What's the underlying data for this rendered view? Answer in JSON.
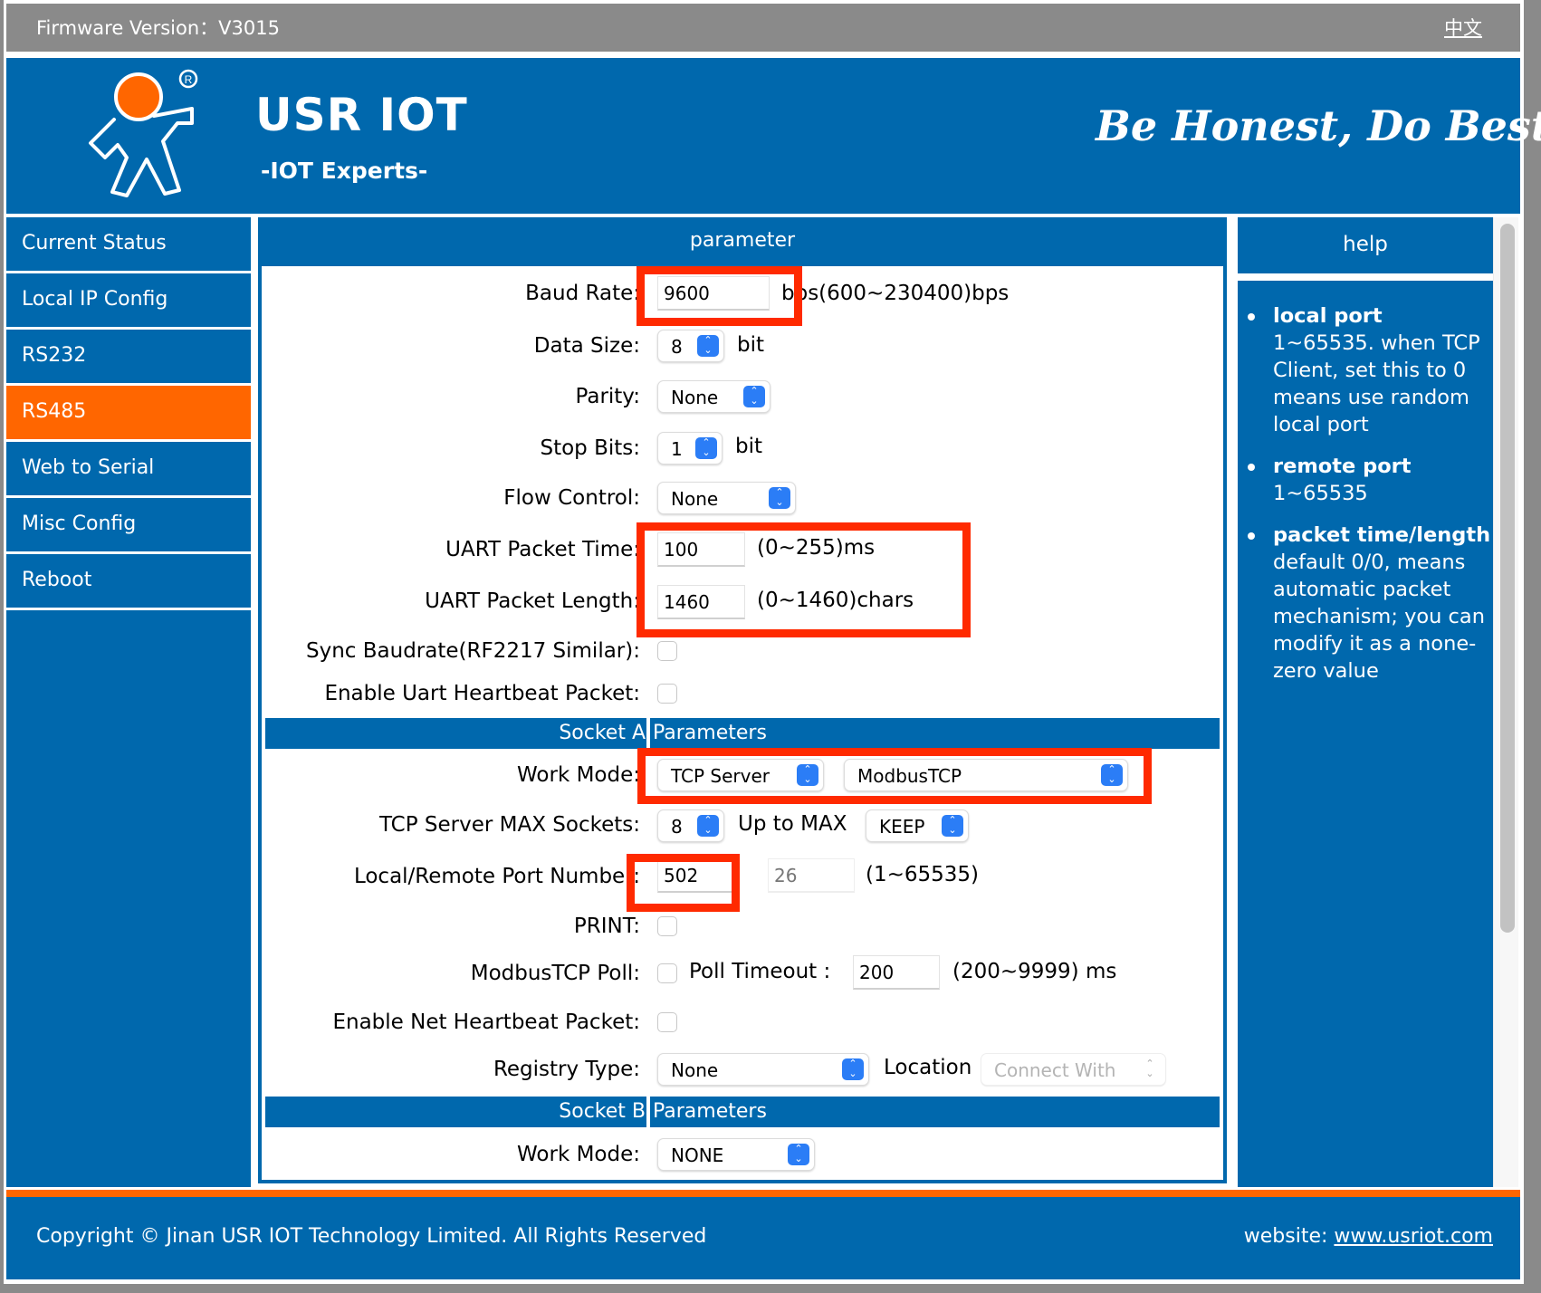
{
  "topbar": {
    "firmware_label": "Firmware Version：V3015",
    "language_link": "中文"
  },
  "header": {
    "brand": "USR IOT",
    "brand_sub": "-IOT Experts-",
    "slogan": "Be Honest, Do Best!",
    "logo_icon": "usr-iot-mascot-logo"
  },
  "colors": {
    "brand_blue": "#0068ad",
    "accent_orange": "#ff6600",
    "highlight_red": "#ff2a00",
    "select_blue": "#2b7df6"
  },
  "sidebar": {
    "items": [
      {
        "label": "Current Status",
        "active": false
      },
      {
        "label": "Local IP Config",
        "active": false
      },
      {
        "label": "RS232",
        "active": false
      },
      {
        "label": "RS485",
        "active": true
      },
      {
        "label": "Web to Serial",
        "active": false
      },
      {
        "label": "Misc Config",
        "active": false
      },
      {
        "label": "Reboot",
        "active": false
      }
    ]
  },
  "main": {
    "title": "parameter",
    "baud_rate": {
      "label": "Baud Rate:",
      "value": "9600",
      "hint": "bps(600~230400)bps"
    },
    "data_size": {
      "label": "Data Size:",
      "value": "8",
      "unit": "bit"
    },
    "parity": {
      "label": "Parity:",
      "value": "None"
    },
    "stop_bits": {
      "label": "Stop Bits:",
      "value": "1",
      "unit": "bit"
    },
    "flow_control": {
      "label": "Flow Control:",
      "value": "None"
    },
    "uart_packet_time": {
      "label": "UART Packet Time:",
      "value": "100",
      "hint": "(0~255)ms"
    },
    "uart_packet_length": {
      "label": "UART Packet Length:",
      "value": "1460",
      "hint": "(0~1460)chars"
    },
    "sync_baudrate": {
      "label": "Sync Baudrate(RF2217 Similar):",
      "checked": false
    },
    "uart_heartbeat": {
      "label": "Enable Uart Heartbeat Packet:",
      "checked": false
    },
    "socket_a": {
      "title_left": "Socket A",
      "title_right": "Parameters",
      "work_mode": {
        "label": "Work Mode:",
        "value": "TCP Server",
        "protocol": "ModbusTCP"
      },
      "max_sockets": {
        "label": "TCP Server MAX Sockets:",
        "value": "8",
        "up_to_max_label": "Up to MAX",
        "up_to_max_value": "KEEP"
      },
      "port_number": {
        "label": "Local/Remote Port Number:",
        "local": "502",
        "remote": "26",
        "hint": "(1~65535)"
      },
      "print": {
        "label": "PRINT:",
        "checked": false
      },
      "modbus_poll": {
        "label": "ModbusTCP Poll:",
        "checked": false,
        "timeout_label": "Poll Timeout :",
        "timeout_value": "200",
        "timeout_hint": "(200~9999) ms"
      },
      "net_heartbeat": {
        "label": "Enable Net Heartbeat Packet:",
        "checked": false
      },
      "registry": {
        "label": "Registry Type:",
        "value": "None",
        "location_label": "Location",
        "location_value": "Connect With"
      }
    },
    "socket_b": {
      "title_left": "Socket B",
      "title_right": "Parameters",
      "work_mode": {
        "label": "Work Mode:",
        "value": "NONE"
      }
    }
  },
  "help": {
    "title": "help",
    "items": [
      {
        "term": "local port",
        "text": "1~65535. when TCP Client, set this to 0 means use random local port"
      },
      {
        "term": "remote port",
        "text": "1~65535"
      },
      {
        "term": "packet time/length",
        "text": "default 0/0, means automatic packet mechanism; you can modify it as a none-zero value"
      }
    ]
  },
  "footer": {
    "copyright": "Copyright © Jinan USR IOT Technology Limited. All Rights Reserved",
    "website_label": "website: ",
    "website_link": "www.usriot.com"
  }
}
